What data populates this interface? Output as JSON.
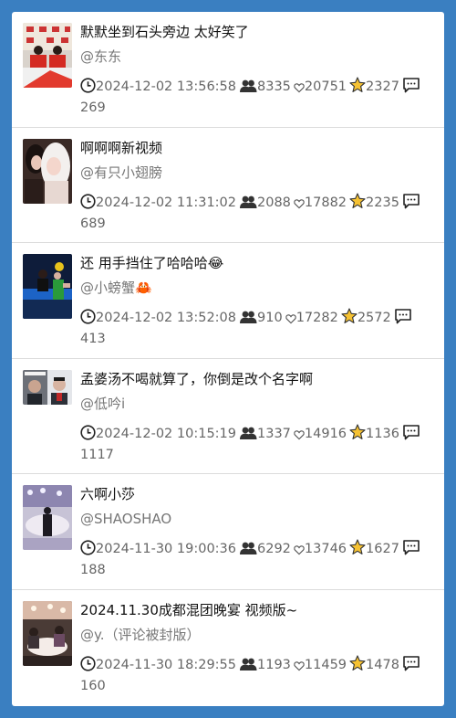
{
  "items": [
    {
      "title": "默默坐到石头旁边 太好笑了",
      "author": "@东东",
      "time": "2024-12-02 13:56:58",
      "users": "8335",
      "likes": "20751",
      "stars": "2327",
      "comments": "269",
      "thumb": "red-press"
    },
    {
      "title": "啊啊啊新视频",
      "author": "@有只小翅膀",
      "time": "2024-12-02 11:31:02",
      "users": "2088",
      "likes": "17882",
      "stars": "2235",
      "comments": "689",
      "thumb": "portrait"
    },
    {
      "title": "还 用手挡住了哈哈哈😂",
      "author": "@小螃蟹🦀",
      "time": "2024-12-02 13:52:08",
      "users": "910",
      "likes": "17282",
      "stars": "2572",
      "comments": "413",
      "thumb": "table-tennis"
    },
    {
      "title": "孟婆汤不喝就算了，你倒是改个名字啊",
      "author": "@低吟i",
      "time": "2024-12-02 10:15:19",
      "users": "1337",
      "likes": "14916",
      "stars": "1136",
      "comments": "1117",
      "thumb": "split-faces"
    },
    {
      "title": "六啊小莎",
      "author": "@SHAOSHAO",
      "time": "2024-11-30 19:00:36",
      "users": "6292",
      "likes": "13746",
      "stars": "1627",
      "comments": "188",
      "thumb": "banquet"
    },
    {
      "title": "2024.11.30成都混团晚宴 视频版~",
      "author": "@y.（评论被封版）",
      "time": "2024-11-30 18:29:55",
      "users": "1193",
      "likes": "11459",
      "stars": "1478",
      "comments": "160",
      "thumb": "dinner"
    }
  ]
}
